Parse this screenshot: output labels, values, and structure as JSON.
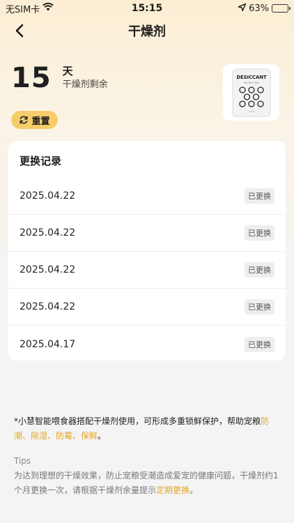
{
  "status_bar": {
    "carrier": "无SIM卡",
    "time": "15:15",
    "battery": "63%",
    "battery_level": 0.63
  },
  "nav": {
    "title": "干燥剂"
  },
  "summary": {
    "days": "15",
    "unit": "天",
    "label": "干燥剂剩余"
  },
  "product": {
    "brand": "DESICCANT",
    "warning": "DO NOT EAT",
    "weight": "2.5G"
  },
  "reset_button": {
    "label": "重置"
  },
  "history": {
    "title": "更换记录",
    "items": [
      {
        "date": "2025.04.22",
        "status": "已更换"
      },
      {
        "date": "2025.04.22",
        "status": "已更换"
      },
      {
        "date": "2025.04.22",
        "status": "已更换"
      },
      {
        "date": "2025.04.22",
        "status": "已更换"
      },
      {
        "date": "2025.04.17",
        "status": "已更换"
      }
    ]
  },
  "note": {
    "text": "*小慧智能喂食器搭配干燥剂使用，可形成多重锁鲜保护，帮助宠粮",
    "highlight": "防潮、除湿、防霉、保鲜",
    "end": "。"
  },
  "tips": {
    "title": "Tips",
    "text": "为达到理想的干燥效果，防止宠粮受潮造成爱宠的健康问题，干燥剂约1个月更换一次，请根据干燥剂余量提示",
    "highlight": "定期更换",
    "end": "。"
  },
  "colors": {
    "accent": "#e3a92a",
    "button": "#f7cd6a",
    "background_top": "#fbeed3"
  }
}
